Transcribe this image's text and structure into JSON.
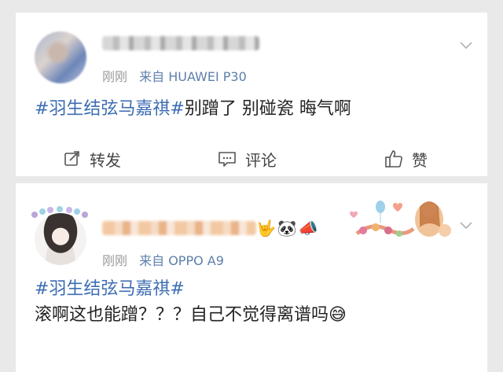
{
  "posts": [
    {
      "time": "刚刚",
      "source": "来自 HUAWEI P30",
      "hashtag": "#羽生结弦马嘉祺#",
      "text": "别蹭了 别碰瓷 晦气啊",
      "actions": {
        "repost": "转发",
        "comment": "评论",
        "like": "赞"
      }
    },
    {
      "time": "刚刚",
      "source": "来自 OPPO A9",
      "emojis": "🤟🐼📣",
      "hashtag": "#羽生结弦马嘉祺#",
      "text": "滚啊这也能蹭？？？自己不觉得离谱吗😅"
    }
  ],
  "colors": {
    "link": "#3d6db3",
    "source": "#5d7faa",
    "meta": "#9a9a9a"
  }
}
